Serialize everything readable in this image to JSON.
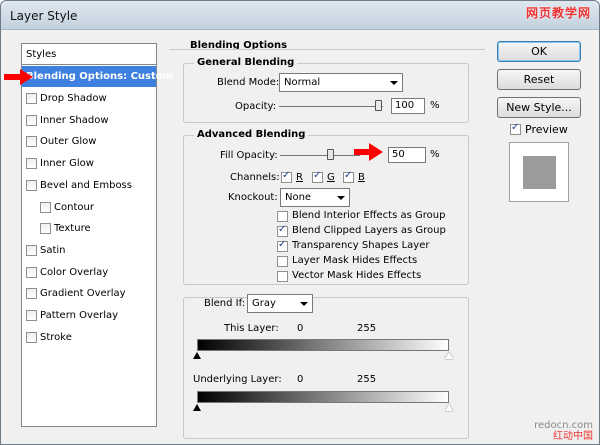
{
  "window": {
    "title": "Layer Style"
  },
  "watermark_top": "网页教学网",
  "watermark_bottom_url": "redocn.com",
  "watermark_bottom": "红动中国",
  "styles_list": {
    "header": "Styles",
    "selected": "Blending Options: Custom",
    "items": [
      {
        "label": "Drop Shadow",
        "checked": false
      },
      {
        "label": "Inner Shadow",
        "checked": false
      },
      {
        "label": "Outer Glow",
        "checked": false
      },
      {
        "label": "Inner Glow",
        "checked": false
      },
      {
        "label": "Bevel and Emboss",
        "checked": false
      },
      {
        "label": "Contour",
        "checked": false
      },
      {
        "label": "Texture",
        "checked": false
      },
      {
        "label": "Satin",
        "checked": false
      },
      {
        "label": "Color Overlay",
        "checked": false
      },
      {
        "label": "Gradient Overlay",
        "checked": false
      },
      {
        "label": "Pattern Overlay",
        "checked": false
      },
      {
        "label": "Stroke",
        "checked": false
      }
    ]
  },
  "blending": {
    "title": "Blending Options",
    "general": {
      "title": "General Blending",
      "blend_mode_label": "Blend Mode:",
      "blend_mode": "Normal",
      "opacity_label": "Opacity:",
      "opacity": "100",
      "opacity_unit": "%"
    },
    "advanced": {
      "title": "Advanced Blending",
      "fill_opacity_label": "Fill Opacity:",
      "fill_opacity": "50",
      "fill_unit": "%",
      "channels_label": "Channels:",
      "channels": [
        {
          "label": "R",
          "checked": true
        },
        {
          "label": "G",
          "checked": true
        },
        {
          "label": "B",
          "checked": true
        }
      ],
      "knockout_label": "Knockout:",
      "knockout": "None",
      "options": [
        {
          "label": "Blend Interior Effects as Group",
          "checked": false
        },
        {
          "label": "Blend Clipped Layers as Group",
          "checked": true
        },
        {
          "label": "Transparency Shapes Layer",
          "checked": true
        },
        {
          "label": "Layer Mask Hides Effects",
          "checked": false
        },
        {
          "label": "Vector Mask Hides Effects",
          "checked": false
        }
      ]
    },
    "blend_if": {
      "label": "Blend If:",
      "value": "Gray",
      "this_layer_label": "This Layer:",
      "this_layer_min": "0",
      "this_layer_max": "255",
      "underlying_label": "Underlying Layer:",
      "underlying_min": "0",
      "underlying_max": "255"
    }
  },
  "buttons": {
    "ok": "OK",
    "reset": "Reset",
    "new_style": "New Style..."
  },
  "preview": {
    "label": "Preview",
    "checked": true
  },
  "colors": {
    "selection": "#3d80df",
    "arrow": "#ff0000",
    "preview_swatch": "#9b9b9b"
  }
}
